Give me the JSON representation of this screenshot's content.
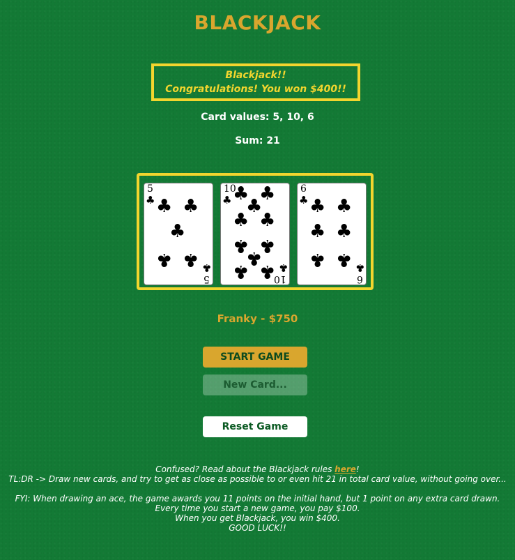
{
  "title": "BLACKJACK",
  "result": {
    "line1": "Blackjack!!",
    "line2": "Congratulations! You won $400!!"
  },
  "card_values_text": "Card values: 5, 10, 6",
  "sum_text": "Sum: 21",
  "cards": [
    {
      "rank": "5",
      "suit": "clubs"
    },
    {
      "rank": "10",
      "suit": "clubs"
    },
    {
      "rank": "6",
      "suit": "clubs"
    }
  ],
  "player_text": "Franky - $750",
  "buttons": {
    "start": "START GAME",
    "new_card": "New Card...",
    "reset": "Reset Game"
  },
  "footer": {
    "rules_prefix": "Confused? Read about the Blackjack rules ",
    "rules_link": "here",
    "rules_suffix": "!",
    "tldr": "TL:DR -> Draw new cards, and try to get as close as possible to or even hit 21 in total card value, without going over...",
    "fyi": "FYI: When drawing an ace, the game awards you 11 points on the initial hand, but 1 point on any extra card drawn.",
    "cost": "Every time you start a new game, you pay $100.",
    "win": "When you get Blackjack, you win $400.",
    "luck": "GOOD LUCK!!"
  }
}
